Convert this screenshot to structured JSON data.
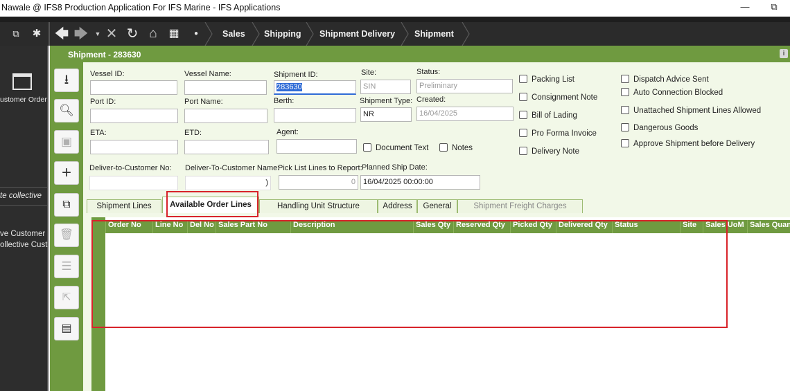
{
  "window": {
    "title": "Nawale @ IFS8 Production Application For IFS Marine - IFS Applications",
    "minimize": "—",
    "restore": "⧉"
  },
  "breadcrumbs": [
    "Sales",
    "Shipping",
    "Shipment Delivery",
    "Shipment"
  ],
  "left_panel": {
    "item1": "ustomer Order",
    "item2": "te collective",
    "item3": "ve Customer",
    "item4": "ollective Cust"
  },
  "header": {
    "title": "Shipment - 283630"
  },
  "form": {
    "vessel_id": {
      "label": "Vessel ID:",
      "value": ""
    },
    "vessel_name": {
      "label": "Vessel Name:",
      "value": ""
    },
    "shipment_id": {
      "label": "Shipment ID:",
      "value": "283630"
    },
    "site": {
      "label": "Site:",
      "value": "SIN"
    },
    "status": {
      "label": "Status:",
      "value": "Preliminary"
    },
    "port_id": {
      "label": "Port ID:",
      "value": ""
    },
    "port_name": {
      "label": "Port Name:",
      "value": ""
    },
    "berth": {
      "label": "Berth:",
      "value": ""
    },
    "shipment_type": {
      "label": "Shipment Type:",
      "value": "NR"
    },
    "created": {
      "label": "Created:",
      "value": "16/04/2025"
    },
    "eta": {
      "label": "ETA:",
      "value": ""
    },
    "etd": {
      "label": "ETD:",
      "value": ""
    },
    "agent": {
      "label": "Agent:",
      "value": ""
    },
    "deliver_to_customer_no": {
      "label": "Deliver-to-Customer No:",
      "value": ""
    },
    "deliver_to_customer_name": {
      "label": "Deliver-To-Customer Name:",
      "value": ")"
    },
    "pick_list_lines": {
      "label": "Pick List Lines to Report:",
      "value": "0"
    },
    "planned_ship_date": {
      "label": "Planned Ship Date:",
      "value": "16/04/2025 00:00:00"
    }
  },
  "checkboxes": {
    "document_text": "Document Text",
    "notes": "Notes",
    "packing_list": "Packing List",
    "consignment_note": "Consignment Note",
    "bill_of_lading": "Bill of Lading",
    "pro_forma_invoice": "Pro Forma Invoice",
    "delivery_note": "Delivery Note",
    "dispatch_advice_sent": "Dispatch Advice Sent",
    "auto_connection_blocked": "Auto Connection Blocked",
    "unattached_lines_allowed": "Unattached Shipment Lines Allowed",
    "dangerous_goods": "Dangerous Goods",
    "approve_before_delivery": "Approve Shipment before Delivery"
  },
  "tabs": [
    "Shipment Lines",
    "Available Order Lines",
    "Handling Unit Structure",
    "Address",
    "General",
    "Shipment Freight Charges"
  ],
  "grid": {
    "columns": [
      "Order No",
      "Line No",
      "Del No",
      "Sales Part No",
      "Description",
      "Sales Qty",
      "Reserved Qty",
      "Picked Qty",
      "Delivered Qty",
      "Status",
      "Site",
      "Sales UoM",
      "Sales Quan"
    ],
    "rows": []
  },
  "colors": {
    "accent_green": "#6f9a40",
    "highlight_red": "#d8232a",
    "form_bg": "#f2f8e8",
    "dark_nav": "#2b2b2b"
  }
}
